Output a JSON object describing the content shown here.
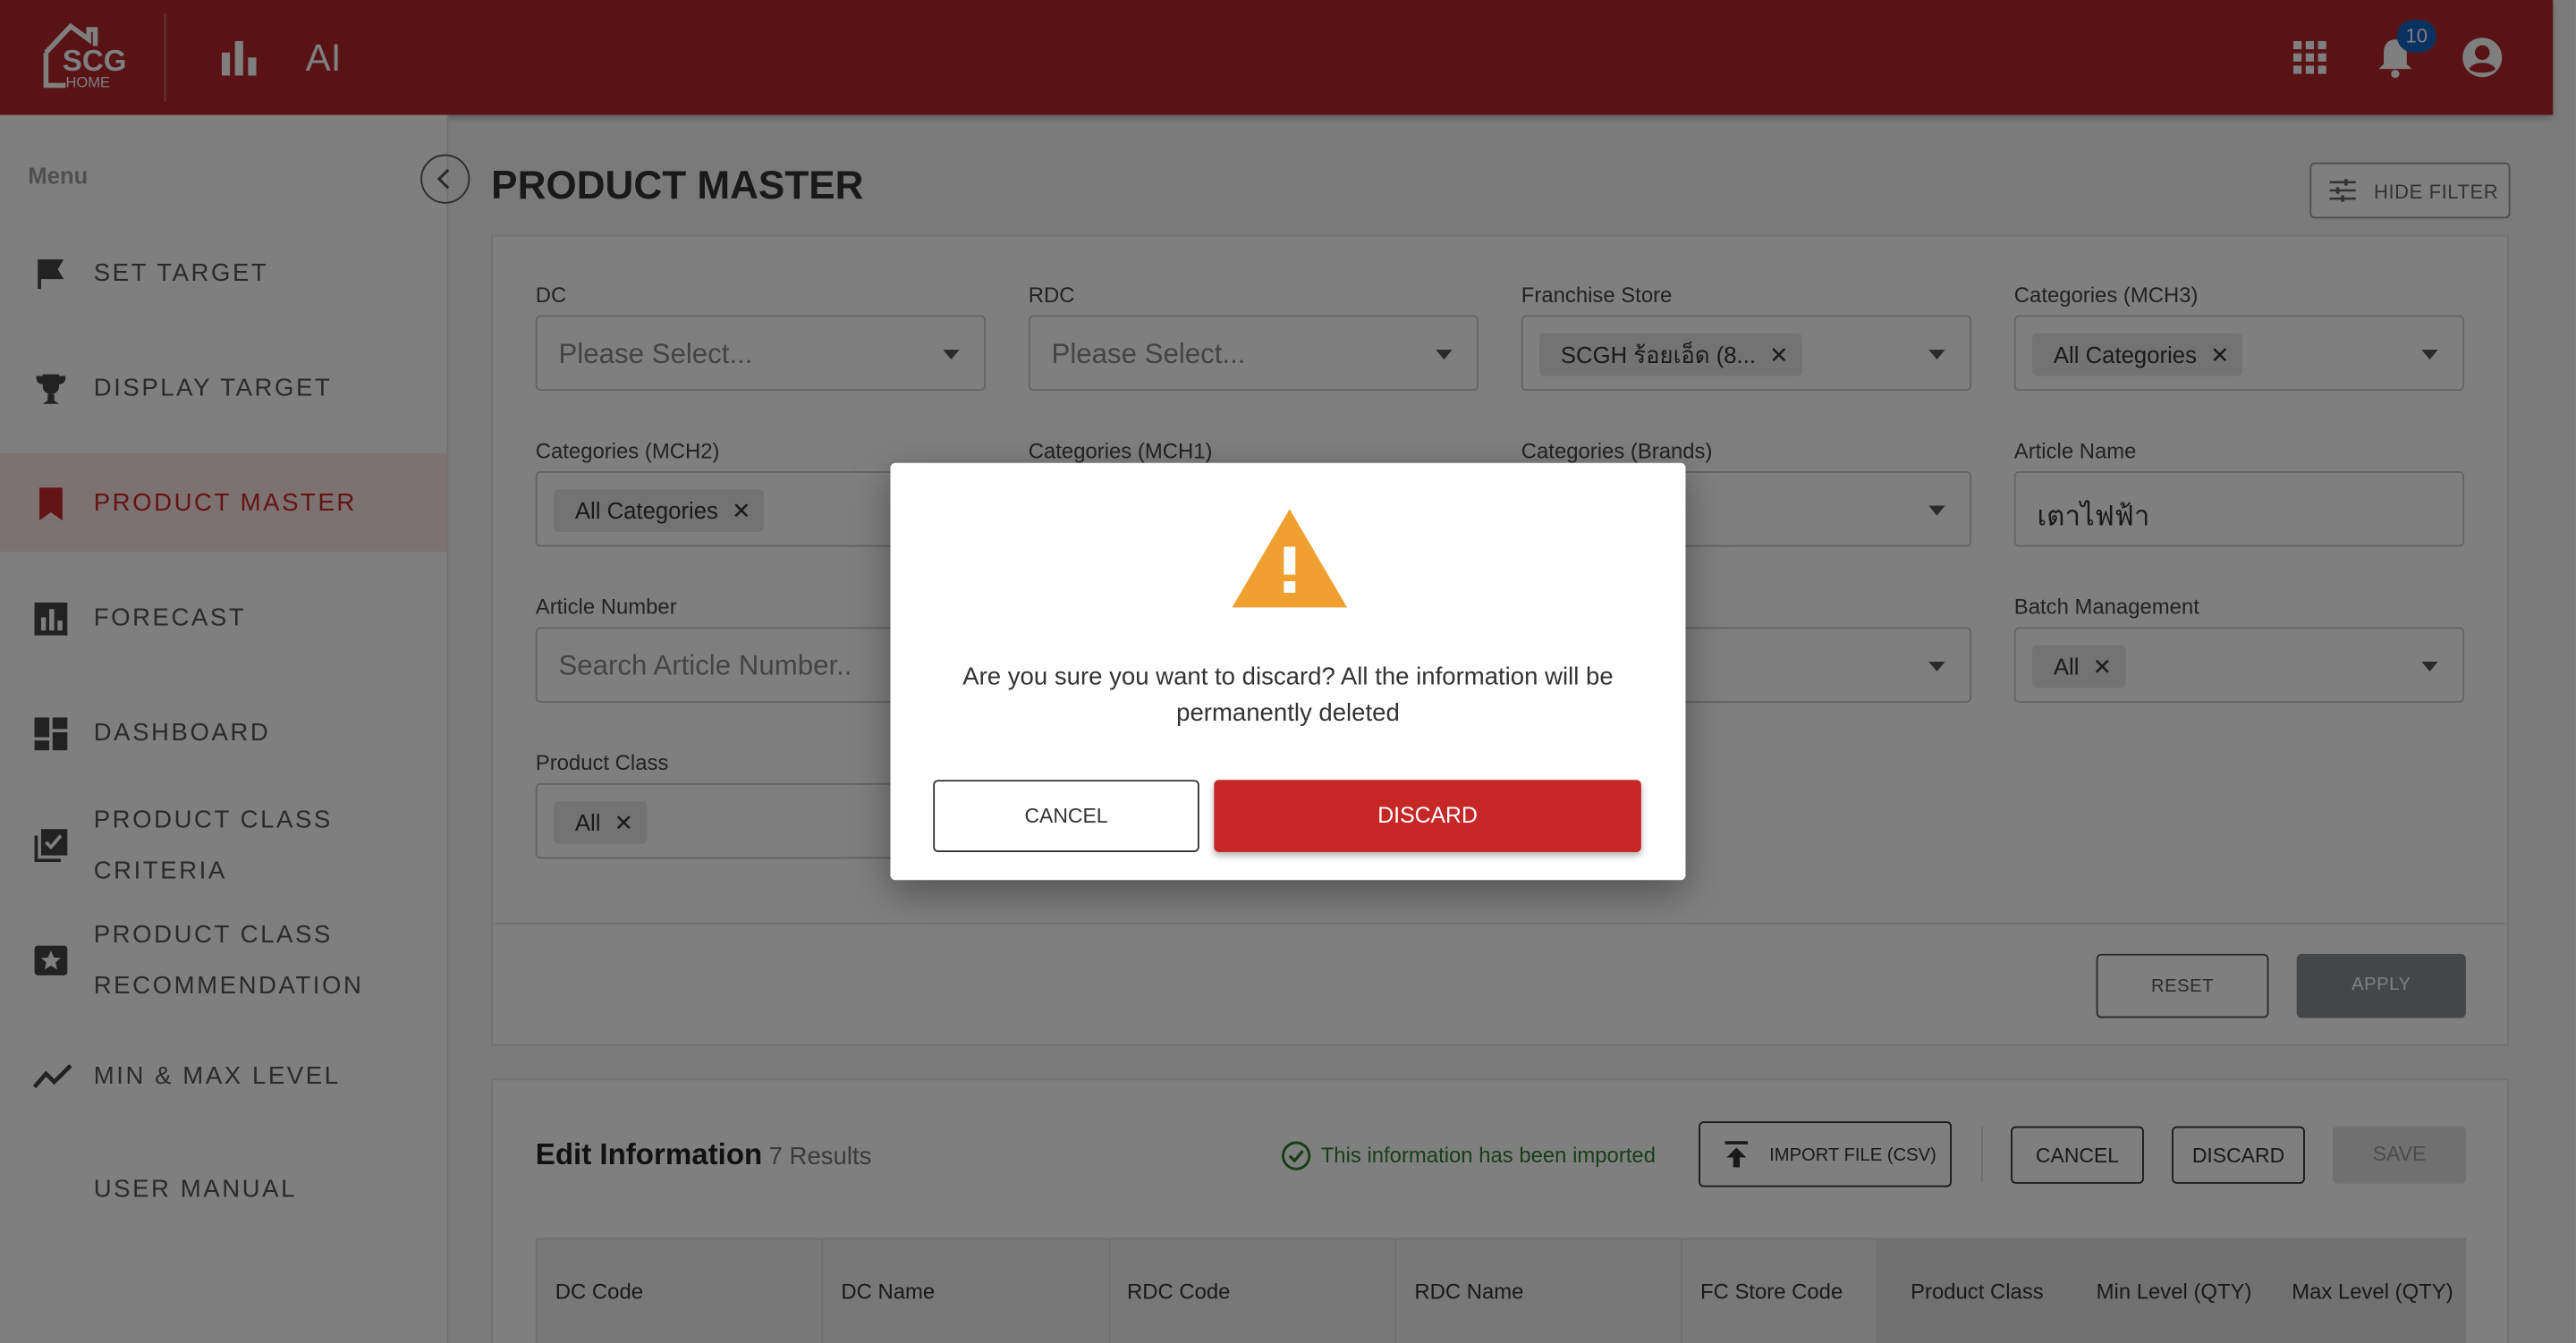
{
  "colors": {
    "topbar": "#b3262a",
    "accent": "#c62828",
    "warning": "#f0a030",
    "success": "#2e7d32",
    "badge": "#1565c0"
  },
  "header": {
    "logo_text": "SCG",
    "logo_sub": "HOME",
    "ai_label": "AI",
    "notification_count": "10",
    "icons": [
      "bar-chart-icon",
      "apps-grid-icon",
      "bell-icon",
      "account-icon"
    ]
  },
  "sidebar": {
    "menu_title": "Menu",
    "items": [
      {
        "label": "SET TARGET",
        "icon": "flag-icon"
      },
      {
        "label": "DISPLAY TARGET",
        "icon": "trophy-icon"
      },
      {
        "label": "PRODUCT MASTER",
        "icon": "bookmark-icon",
        "active": true
      },
      {
        "label": "FORECAST",
        "icon": "chart-box-icon"
      },
      {
        "label": "DASHBOARD",
        "icon": "dashboard-icon"
      },
      {
        "label": "PRODUCT CLASS",
        "label2": "CRITERIA",
        "icon": "checklist-icon"
      },
      {
        "label": "PRODUCT CLASS",
        "label2": "RECOMMENDATION",
        "icon": "star-box-icon"
      },
      {
        "label": "MIN & MAX LEVEL",
        "icon": "trend-icon"
      },
      {
        "label": "USER MANUAL",
        "icon": ""
      }
    ]
  },
  "page": {
    "title": "PRODUCT MASTER",
    "hide_filter": "HIDE FILTER"
  },
  "filters": {
    "dc": {
      "label": "DC",
      "placeholder": "Please Select..."
    },
    "rdc": {
      "label": "RDC",
      "placeholder": "Please Select..."
    },
    "franchise": {
      "label": "Franchise Store",
      "chip": "SCGH ร้อยเอ็ด (8..."
    },
    "mch3": {
      "label": "Categories (MCH3)",
      "chip": "All Categories"
    },
    "mch2": {
      "label": "Categories (MCH2)",
      "chip": "All Categories"
    },
    "mch1": {
      "label": "Categories (MCH1)"
    },
    "brands": {
      "label": "Categories (Brands)"
    },
    "article_name": {
      "label": "Article Name",
      "value": "เตาไฟฟ้า"
    },
    "article_number": {
      "label": "Article Number",
      "placeholder": "Search Article Number.."
    },
    "batch": {
      "label": "Batch Management",
      "chip": "All"
    },
    "product_class": {
      "label": "Product Class",
      "chip": "All"
    },
    "reset": "RESET",
    "apply": "APPLY"
  },
  "edit": {
    "title": "Edit Information",
    "count": "7 Results",
    "imported_msg": "This information has been imported",
    "import_btn": "IMPORT FILE (CSV)",
    "cancel": "CANCEL",
    "discard": "DISCARD",
    "save": "SAVE",
    "columns": [
      "DC Code",
      "DC Name",
      "RDC Code",
      "RDC Name",
      "FC Store Code",
      "Product Class",
      "Min Level (QTY)",
      "Max Level (QTY)"
    ]
  },
  "dialog": {
    "message": "Are you sure you want to discard? All the information will be permanently deleted",
    "cancel": "CANCEL",
    "discard": "DISCARD"
  }
}
